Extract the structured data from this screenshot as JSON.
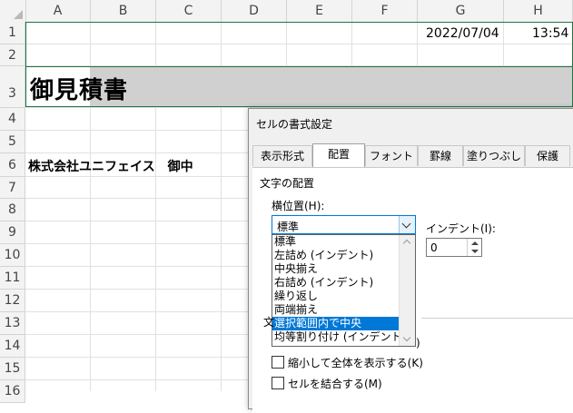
{
  "sheet": {
    "columns": [
      "A",
      "B",
      "C",
      "D",
      "E",
      "F",
      "G",
      "H"
    ],
    "rows": [
      "1",
      "2",
      "3",
      "4",
      "5",
      "6",
      "7",
      "8",
      "9",
      "10",
      "11",
      "12",
      "13",
      "14",
      "15",
      "16"
    ],
    "cells": {
      "G1": "2022/07/04",
      "H1": "13:54",
      "A3": "御見積書",
      "A6": "株式会社ユニフェイス　御中"
    }
  },
  "dialog": {
    "title": "セルの書式設定",
    "tabs": [
      "表示形式",
      "配置",
      "フォント",
      "罫線",
      "塗りつぶし",
      "保護"
    ],
    "active_tab": "配置",
    "section_text_align": "文字の配置",
    "horizontal_label": "横位置(H):",
    "horizontal_value": "標準",
    "horizontal_options": [
      "標準",
      "左詰め (インデント)",
      "中央揃え",
      "右詰め (インデント)",
      "繰り返し",
      "両端揃え",
      "選択範囲内で中央",
      "均等割り付け (インデント)"
    ],
    "highlighted_option": "選択範囲内で中央",
    "indent_label": "インデント(I):",
    "indent_value": "0",
    "partial_label": "文",
    "partial_suffix": ")",
    "shrink_label": "縮小して全体を表示する(K)",
    "merge_label": "セルを結合する(M)"
  }
}
